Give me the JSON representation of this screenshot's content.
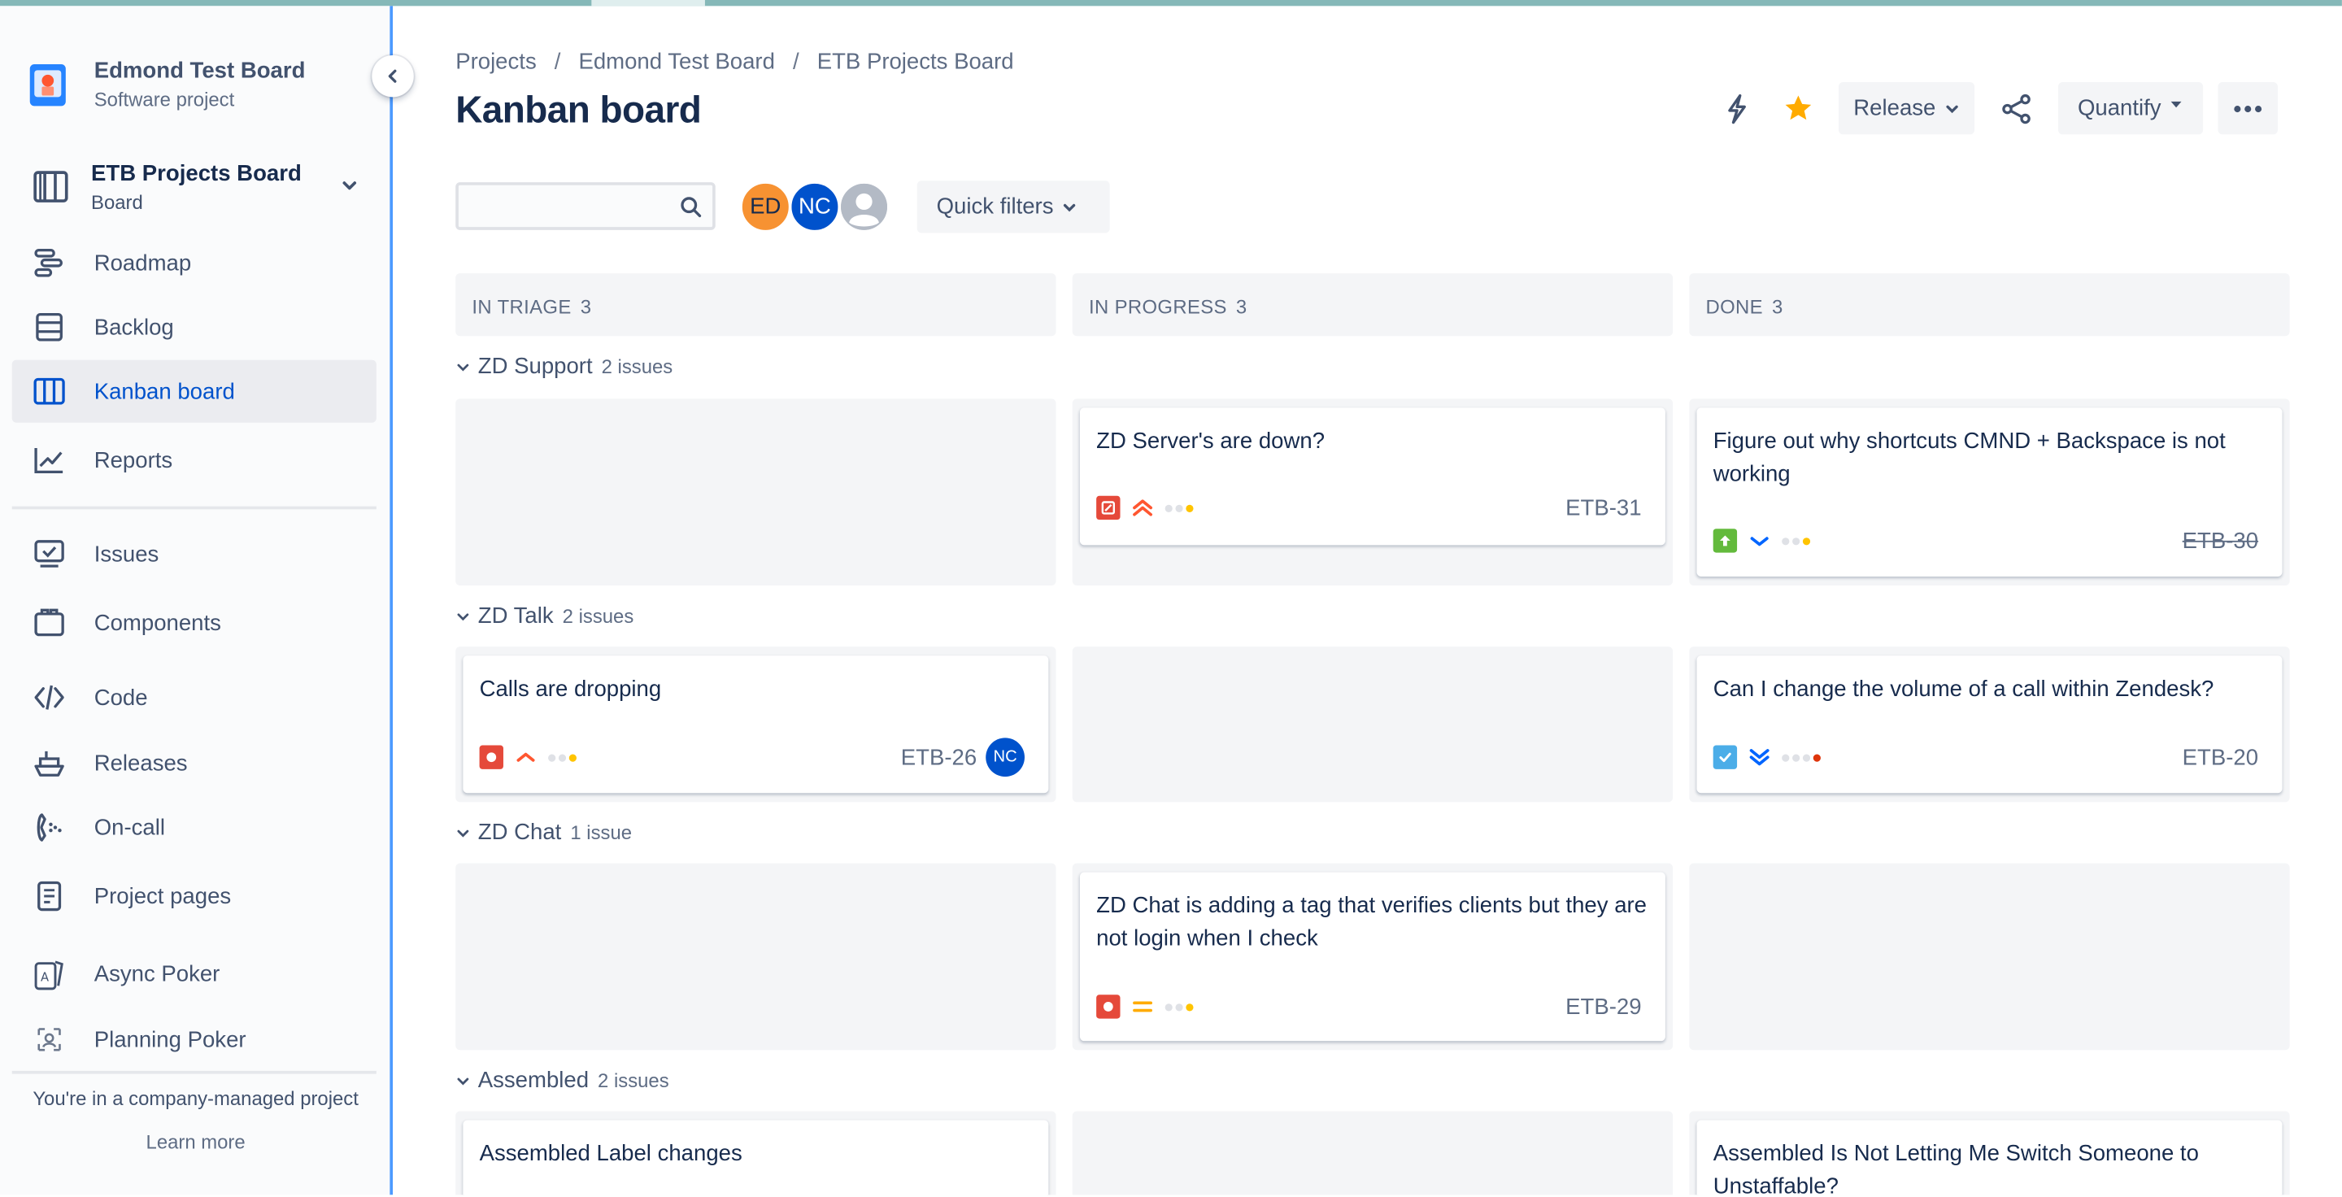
{
  "sidebar": {
    "project_name": "Edmond Test Board",
    "project_type": "Software project",
    "board_name": "ETB Projects Board",
    "board_type": "Board",
    "items": [
      {
        "label": "Roadmap"
      },
      {
        "label": "Backlog"
      },
      {
        "label": "Kanban board"
      },
      {
        "label": "Reports"
      },
      {
        "label": "Issues"
      },
      {
        "label": "Components"
      },
      {
        "label": "Code"
      },
      {
        "label": "Releases"
      },
      {
        "label": "On-call"
      },
      {
        "label": "Project pages"
      },
      {
        "label": "Async Poker"
      },
      {
        "label": "Planning Poker"
      }
    ],
    "footer_text": "You're in a company-managed project",
    "footer_link": "Learn more"
  },
  "breadcrumb": [
    "Projects",
    "Edmond Test Board",
    "ETB Projects Board"
  ],
  "page_title": "Kanban board",
  "header": {
    "release_label": "Release",
    "quantify_label": "Quantify"
  },
  "toolbar": {
    "search_placeholder": "",
    "avatars": [
      "ED",
      "NC"
    ],
    "quick_filters_label": "Quick filters"
  },
  "columns": [
    {
      "name": "IN TRIAGE",
      "count": "3"
    },
    {
      "name": "IN PROGRESS",
      "count": "3"
    },
    {
      "name": "DONE",
      "count": "3"
    }
  ],
  "swimlanes": [
    {
      "name": "ZD Support",
      "count": "2 issues"
    },
    {
      "name": "ZD Talk",
      "count": "2 issues"
    },
    {
      "name": "ZD Chat",
      "count": "1 issue"
    },
    {
      "name": "Assembled",
      "count": "2 issues"
    }
  ],
  "cards": [
    {
      "title": "ZD Server's are down?",
      "key": "ETB-31"
    },
    {
      "title": "Figure out why shortcuts CMND + Backspace is not working",
      "key": "ETB-30"
    },
    {
      "title": "Calls are dropping",
      "key": "ETB-26",
      "assignee": "NC"
    },
    {
      "title": "Can I change the volume of a call within Zendesk?",
      "key": "ETB-20"
    },
    {
      "title": "ZD Chat is adding a tag that verifies clients but they are not login when I check",
      "key": "ETB-29"
    },
    {
      "title": "Assembled Label changes",
      "key": ""
    },
    {
      "title": "Assembled Is Not Letting Me Switch Someone to Unstaffable?",
      "key": ""
    }
  ],
  "colors": {
    "accent": "#0052cc",
    "star": "#ffab00",
    "avatar_ed": "#f79232",
    "avatar_nc": "#0052cc",
    "bug": "#e5493a",
    "story": "#63ba3c",
    "task": "#4bade8"
  }
}
